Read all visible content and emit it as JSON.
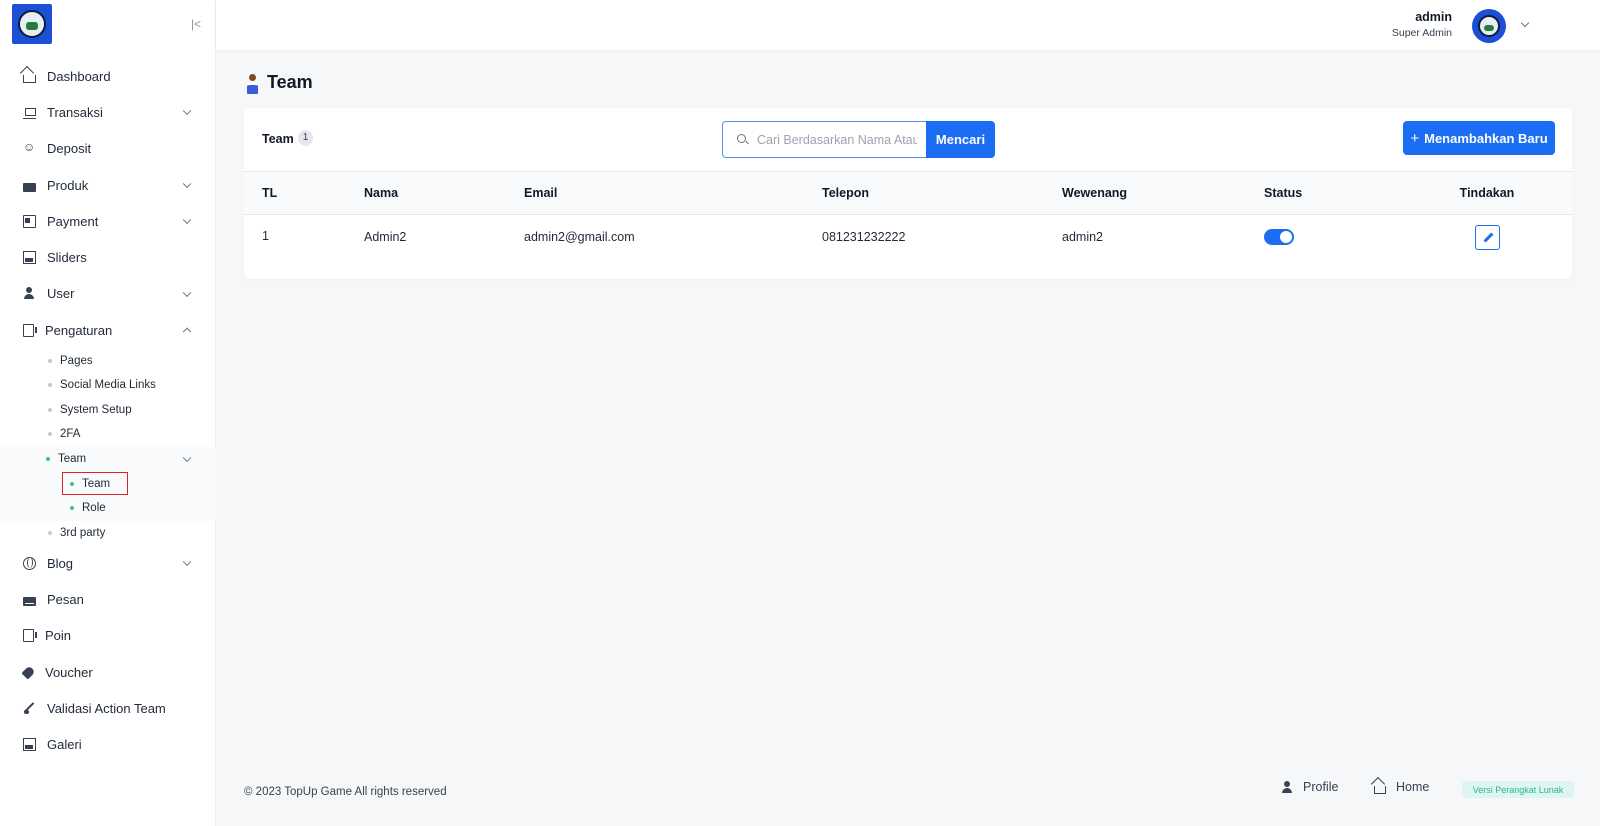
{
  "sidebar": {
    "collapse_icon": "collapse-left-icon",
    "items": [
      {
        "label": "Dashboard",
        "icon": "home-icon"
      },
      {
        "label": "Transaksi",
        "icon": "cart-icon"
      },
      {
        "label": "Deposit",
        "icon": "deposit-icon"
      },
      {
        "label": "Produk",
        "icon": "store-icon"
      },
      {
        "label": "Payment",
        "icon": "card-icon"
      },
      {
        "label": "Sliders",
        "icon": "image-icon"
      },
      {
        "label": "User",
        "icon": "user-icon"
      },
      {
        "label": "Pengaturan",
        "icon": "settings-icon"
      },
      {
        "label": "Blog",
        "icon": "globe-icon"
      },
      {
        "label": "Pesan",
        "icon": "mail-icon"
      },
      {
        "label": "Poin",
        "icon": "points-icon"
      },
      {
        "label": "Voucher",
        "icon": "tag-icon"
      },
      {
        "label": "Validasi Action Team",
        "icon": "brush-icon"
      },
      {
        "label": "Galeri",
        "icon": "gallery-icon"
      }
    ],
    "pengaturan_sub": [
      {
        "label": "Pages"
      },
      {
        "label": "Social Media Links"
      },
      {
        "label": "System Setup"
      },
      {
        "label": "2FA"
      },
      {
        "label": "Team"
      },
      {
        "label": "3rd party"
      }
    ],
    "team_sub": [
      {
        "label": "Team"
      },
      {
        "label": "Role"
      }
    ],
    "active_color": "#34c77b"
  },
  "header": {
    "user_name": "admin",
    "user_role": "Super Admin"
  },
  "page": {
    "title": "Team"
  },
  "card": {
    "title": "Team",
    "count": "1",
    "search_placeholder": "Cari Berdasarkan Nama Atau Email",
    "search_button": "Mencari",
    "add_button": "Menambahkan Baru"
  },
  "table": {
    "headers": [
      "TL",
      "Nama",
      "Email",
      "Telepon",
      "Wewenang",
      "Status",
      "Tindakan"
    ],
    "rows": [
      {
        "tl": "1",
        "nama": "Admin2",
        "email": "admin2@gmail.com",
        "telepon": "081231232222",
        "wewenang": "admin2",
        "status_on": true
      }
    ]
  },
  "footer": {
    "copyright": "© 2023 TopUp Game All rights reserved",
    "profile_link": "Profile",
    "home_link": "Home",
    "version_badge": "Versi Perangkat Lunak"
  },
  "colors": {
    "primary": "#1b6ef3",
    "highlight_border": "#e02424",
    "badge_text": "#2bb39a"
  }
}
